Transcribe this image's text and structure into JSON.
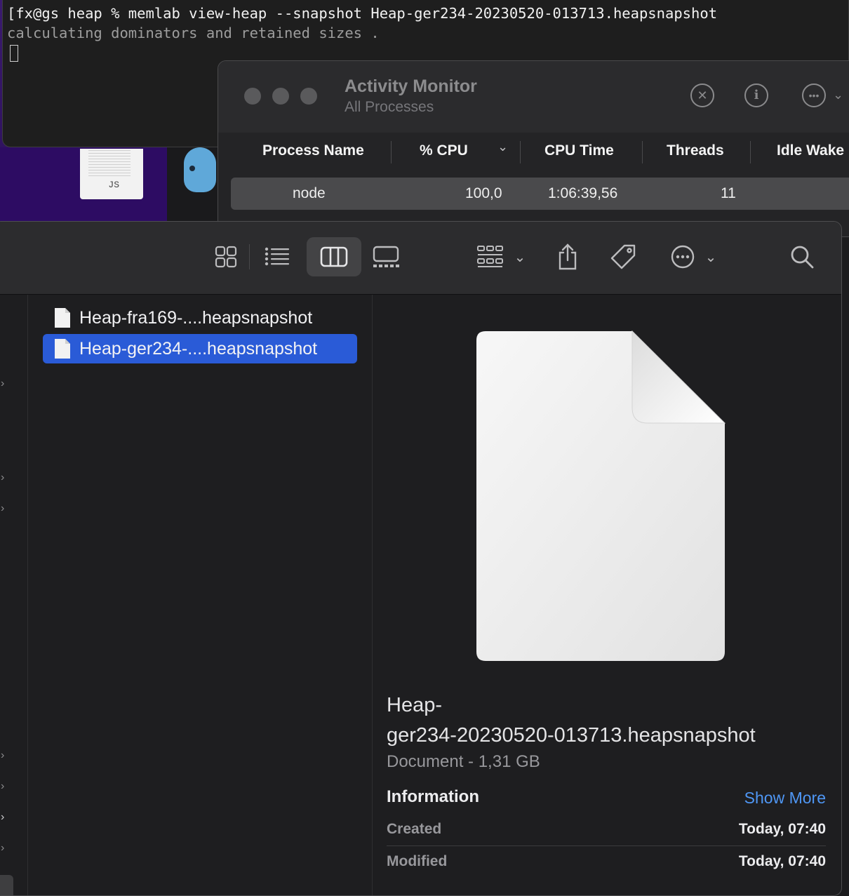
{
  "terminal": {
    "command": "[fx@gs heap % memlab view-heap --snapshot Heap-ger234-20230520-013713.heapsnapshot",
    "output": "calculating dominators and retained sizes ."
  },
  "desktop": {
    "js_file_label": "JS"
  },
  "activity_monitor": {
    "title": "Activity Monitor",
    "subtitle": "All Processes",
    "columns": [
      "Process Name",
      "% CPU",
      "CPU Time",
      "Threads",
      "Idle Wake"
    ],
    "row": {
      "name": "node",
      "cpu": "100,0",
      "cpu_time": "1:06:39,56",
      "threads": "11"
    }
  },
  "finder": {
    "files": [
      {
        "name": "Heap-fra169-....heapsnapshot",
        "selected": false
      },
      {
        "name": "Heap-ger234-....heapsnapshot",
        "selected": true
      }
    ],
    "preview": {
      "name_line1": "Heap-",
      "name_line2": "ger234-20230520-013713.heapsnapshot",
      "kind": "Document - 1,31 GB",
      "info_title": "Information",
      "show_more": "Show More",
      "created_label": "Created",
      "created_value": "Today, 07:40",
      "modified_label": "Modified",
      "modified_value": "Today, 07:40"
    }
  },
  "colors": {
    "selection": "#2a5bd7",
    "link": "#4f97f5"
  }
}
